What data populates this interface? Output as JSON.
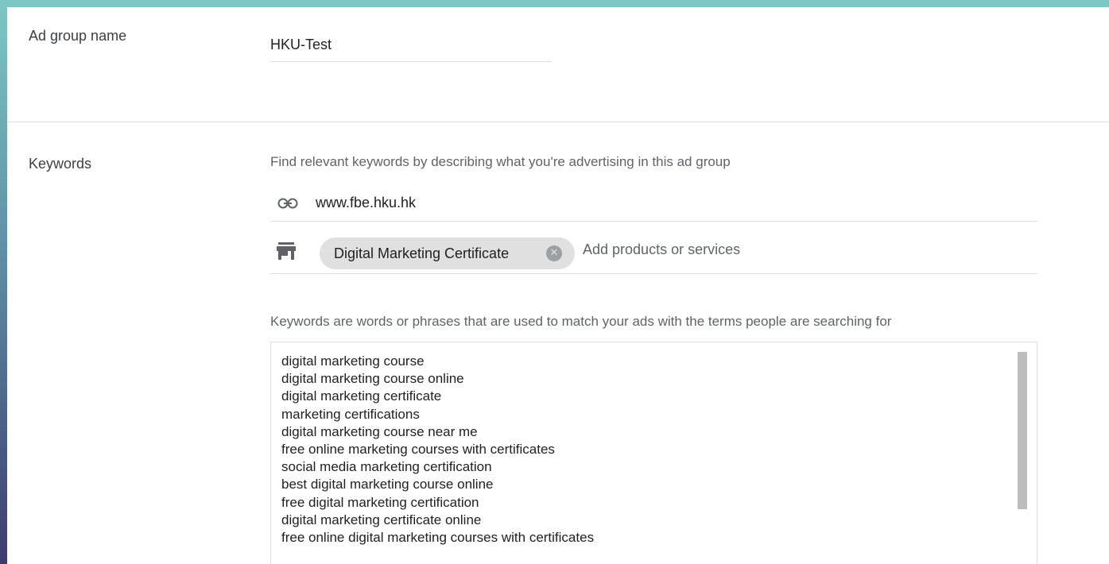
{
  "ad_group": {
    "label": "Ad group name",
    "value": "HKU-Test"
  },
  "keywords": {
    "label": "Keywords",
    "find_hint": "Find relevant keywords by describing what you're advertising in this ad group",
    "url_icon": "link-icon",
    "url": "www.fbe.hku.hk",
    "products_icon": "store-icon",
    "product_chip": "Digital Marketing Certificate",
    "chip_close_icon": "close-circle-icon",
    "products_placeholder": "Add products or services",
    "box_hint": "Keywords are words or phrases that are used to match your ads with the terms people are searching for",
    "list": [
      "digital marketing course",
      "digital marketing course online",
      "digital marketing certificate",
      "marketing certifications",
      "digital marketing course near me",
      "free online marketing courses with certificates",
      "social media marketing certification",
      "best digital marketing course online",
      "free digital marketing certification",
      "digital marketing certificate online",
      "free online digital marketing courses with certificates"
    ]
  },
  "colors": {
    "background_top": "#7cc7c3",
    "background_bottom": "#3d3c6e",
    "chip": "#e0e0e0",
    "divider": "#dadce0"
  }
}
